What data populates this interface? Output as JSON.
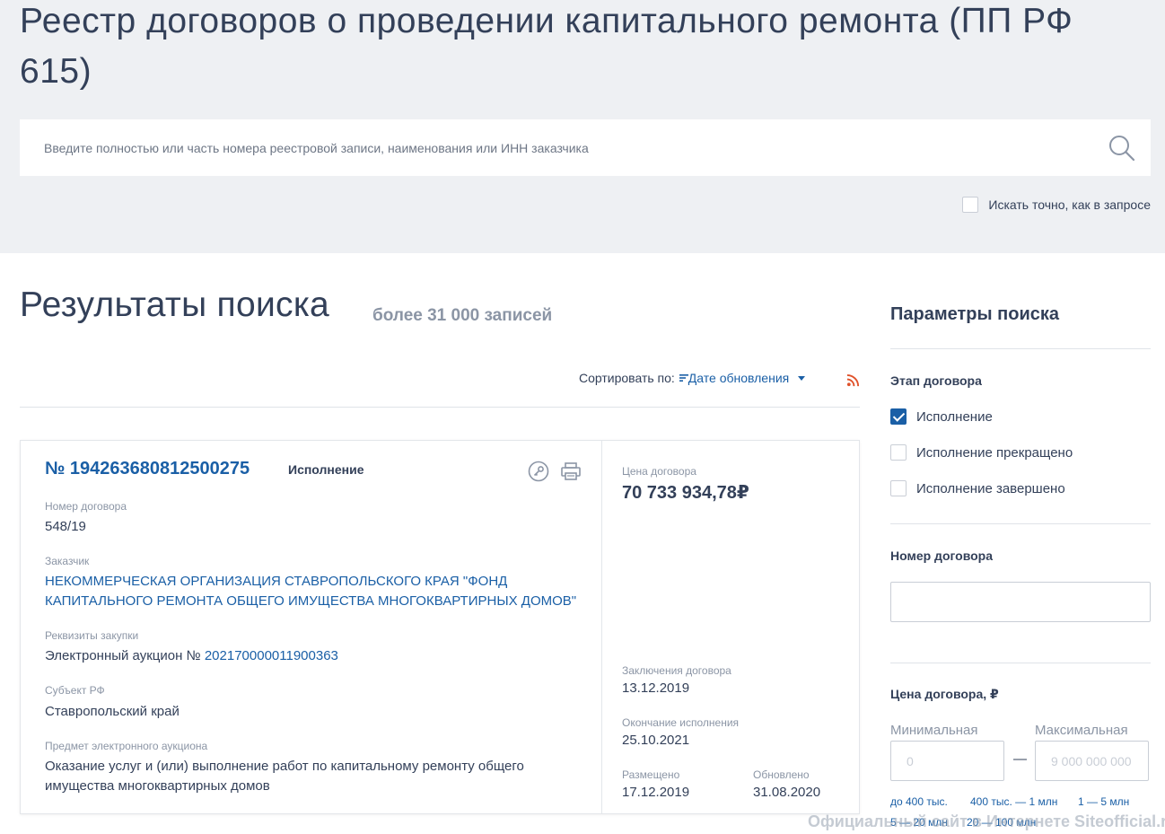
{
  "header": {
    "title": "Реестр договоров о проведении капитального ремонта (ПП РФ 615)",
    "search_placeholder": "Введите полностью или часть номера реестровой записи, наименования или ИНН заказчика",
    "exact_label": "Искать точно, как в запросе"
  },
  "results": {
    "title": "Результаты поиска",
    "count": "более 31 000 записей",
    "sort_label": "Сортировать по:",
    "sort_value": "Дате обновления"
  },
  "card": {
    "number": "№ 194263680812500275",
    "status": "Исполнение",
    "contract_num_label": "Номер договора",
    "contract_num": "548/19",
    "customer_label": "Заказчик",
    "customer_line1": "НЕКОММЕРЧЕСКАЯ ОРГАНИЗАЦИЯ СТАВРОПОЛЬСКОГО КРАЯ \"ФОНД",
    "customer_line2": "КАПИТАЛЬНОГО РЕМОНТА ОБЩЕГО ИМУЩЕСТВА МНОГОКВАРТИРНЫХ ДОМОВ\"",
    "purchase_label": "Реквизиты закупки",
    "purchase_prefix": "Электронный аукцион №",
    "purchase_num": "202170000011900363",
    "region_label": "Субъект РФ",
    "region": "Ставропольский край",
    "subject_label": "Предмет электронного аукциона",
    "subject_line1": "Оказание услуг и (или) выполнение работ по капитальному ремонту общего",
    "subject_line2": "имущества многоквартирных домов",
    "price_label": "Цена договора",
    "price": "70 733 934,78₽",
    "concluded_label": "Заключения договора",
    "concluded": "13.12.2019",
    "end_label": "Окончание исполнения",
    "end": "25.10.2021",
    "placed_label": "Размещено",
    "placed": "17.12.2019",
    "updated_label": "Обновлено",
    "updated": "31.08.2020"
  },
  "sidebar": {
    "title": "Параметры поиска",
    "stage_title": "Этап договора",
    "stages": [
      {
        "label": "Исполнение",
        "checked": true
      },
      {
        "label": "Исполнение прекращено",
        "checked": false
      },
      {
        "label": "Исполнение завершено",
        "checked": false
      }
    ],
    "contract_num_title": "Номер договора",
    "price_title": "Цена договора, ₽",
    "min_label": "Минимальная",
    "max_label": "Максимальная",
    "min_placeholder": "0",
    "max_placeholder": "9 000 000 000",
    "quick": [
      "до 400 тыс.",
      "400 тыс. — 1 млн",
      "1 — 5 млн",
      "5 — 20 млн",
      "20 — 100 млн"
    ]
  },
  "watermark": "Официальный сайт в Интернете Siteofficial.ru",
  "colors": {
    "accent": "#1a5fa6",
    "rss": "#e0522b",
    "header_bg": "#eef0f3"
  }
}
